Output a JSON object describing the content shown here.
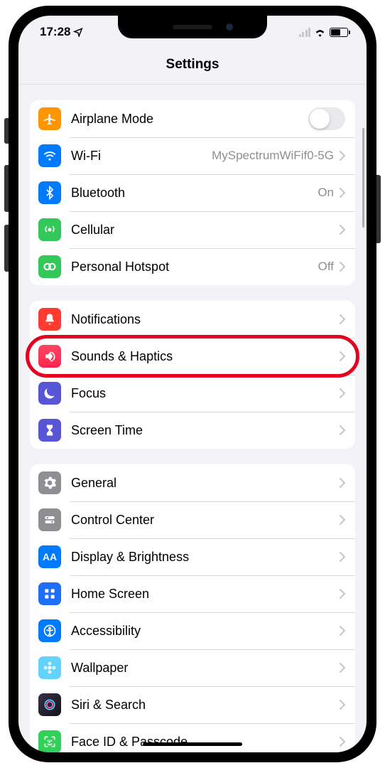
{
  "status": {
    "time": "17:28",
    "location_arrow": true
  },
  "header": {
    "title": "Settings"
  },
  "groups": [
    {
      "rows": [
        {
          "id": "airplane",
          "label": "Airplane Mode",
          "icon": "airplane-icon",
          "color": "bg-orange",
          "type": "toggle",
          "toggle": false
        },
        {
          "id": "wifi",
          "label": "Wi-Fi",
          "icon": "wifi-icon",
          "color": "bg-blue",
          "type": "link",
          "value": "MySpectrumWiFif0-5G"
        },
        {
          "id": "bluetooth",
          "label": "Bluetooth",
          "icon": "bluetooth-icon",
          "color": "bg-blue",
          "type": "link",
          "value": "On"
        },
        {
          "id": "cellular",
          "label": "Cellular",
          "icon": "cellular-icon",
          "color": "bg-green",
          "type": "link",
          "value": ""
        },
        {
          "id": "hotspot",
          "label": "Personal Hotspot",
          "icon": "hotspot-icon",
          "color": "bg-green",
          "type": "link",
          "value": "Off"
        }
      ]
    },
    {
      "rows": [
        {
          "id": "notifications",
          "label": "Notifications",
          "icon": "bell-icon",
          "color": "bg-red",
          "type": "link"
        },
        {
          "id": "sounds",
          "label": "Sounds & Haptics",
          "icon": "speaker-icon",
          "color": "bg-pink",
          "type": "link",
          "highlighted": true
        },
        {
          "id": "focus",
          "label": "Focus",
          "icon": "moon-icon",
          "color": "bg-indigo",
          "type": "link"
        },
        {
          "id": "screentime",
          "label": "Screen Time",
          "icon": "hourglass-icon",
          "color": "bg-indigo",
          "type": "link"
        }
      ]
    },
    {
      "rows": [
        {
          "id": "general",
          "label": "General",
          "icon": "gear-icon",
          "color": "bg-gray",
          "type": "link"
        },
        {
          "id": "controlcenter",
          "label": "Control Center",
          "icon": "switches-icon",
          "color": "bg-gray",
          "type": "link"
        },
        {
          "id": "display",
          "label": "Display & Brightness",
          "icon": "aa-icon",
          "color": "bg-blueA",
          "type": "link"
        },
        {
          "id": "homescreen",
          "label": "Home Screen",
          "icon": "grid-icon",
          "color": "bg-darkblue",
          "type": "link"
        },
        {
          "id": "accessibility",
          "label": "Accessibility",
          "icon": "person-icon",
          "color": "bg-blueA",
          "type": "link"
        },
        {
          "id": "wallpaper",
          "label": "Wallpaper",
          "icon": "flower-icon",
          "color": "bg-teal",
          "type": "link"
        },
        {
          "id": "siri",
          "label": "Siri & Search",
          "icon": "siri-icon",
          "color": "bg-siri",
          "type": "link"
        },
        {
          "id": "faceid",
          "label": "Face ID & Passcode",
          "icon": "faceid-icon",
          "color": "bg-facegreen",
          "type": "link"
        }
      ]
    }
  ]
}
